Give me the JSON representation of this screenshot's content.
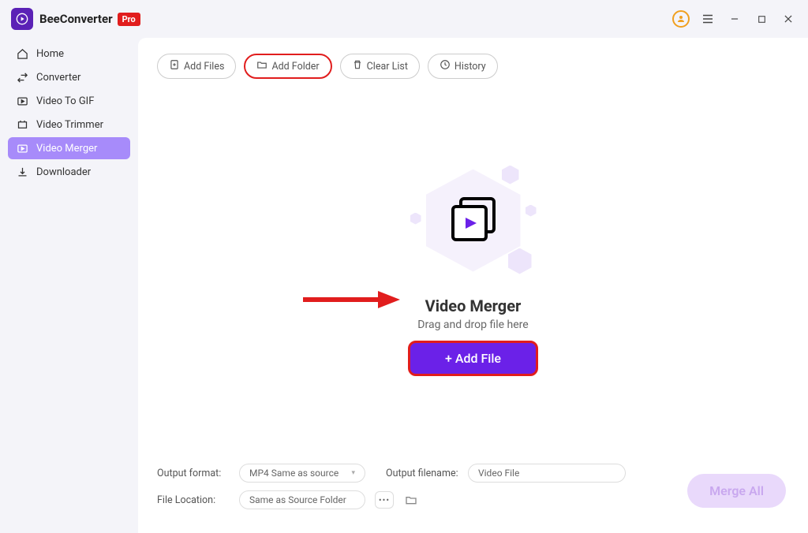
{
  "app": {
    "name": "BeeConverter",
    "badge": "Pro"
  },
  "sidebar": {
    "items": [
      {
        "label": "Home"
      },
      {
        "label": "Converter"
      },
      {
        "label": "Video To GIF"
      },
      {
        "label": "Video Trimmer"
      },
      {
        "label": "Video Merger"
      },
      {
        "label": "Downloader"
      }
    ]
  },
  "toolbar": {
    "add_files": "Add Files",
    "add_folder": "Add Folder",
    "clear_list": "Clear List",
    "history": "History"
  },
  "drop": {
    "title": "Video Merger",
    "subtitle": "Drag and drop file here",
    "button": "+ Add File"
  },
  "bottom": {
    "format_label": "Output format:",
    "format_value": "MP4 Same as source",
    "filename_label": "Output filename:",
    "filename_value": "Video File",
    "location_label": "File Location:",
    "location_value": "Same as Source Folder"
  },
  "merge_button": "Merge All"
}
